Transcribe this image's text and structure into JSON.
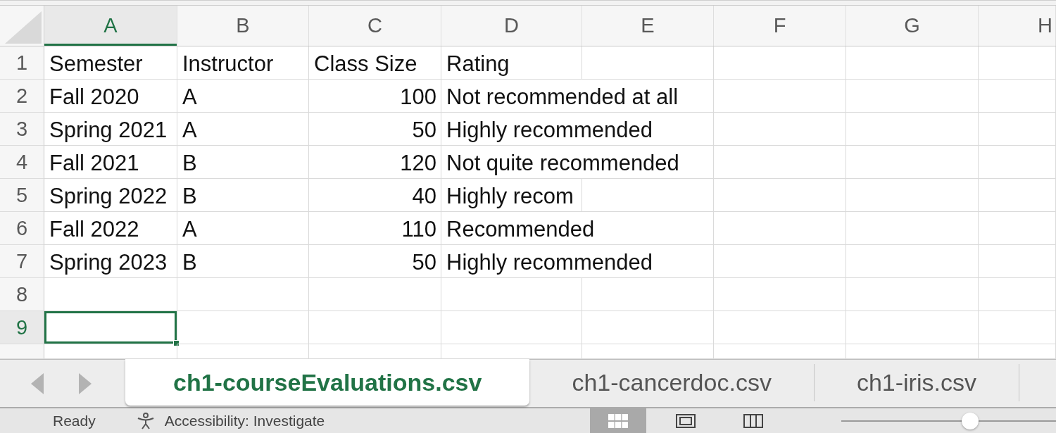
{
  "columns": [
    {
      "label": "A",
      "selected": true
    },
    {
      "label": "B",
      "selected": false
    },
    {
      "label": "C",
      "selected": false
    },
    {
      "label": "D",
      "selected": false
    },
    {
      "label": "E",
      "selected": false
    },
    {
      "label": "F",
      "selected": false
    },
    {
      "label": "G",
      "selected": false
    },
    {
      "label": "H",
      "selected": false
    }
  ],
  "rows": [
    {
      "number": "1",
      "selected": false,
      "cells": [
        {
          "text": "Semester",
          "kind": "text"
        },
        {
          "text": "Instructor",
          "kind": "text"
        },
        {
          "text": "Class Size",
          "kind": "text"
        },
        {
          "text": "Rating",
          "kind": "text"
        }
      ]
    },
    {
      "number": "2",
      "selected": false,
      "cells": [
        {
          "text": "Fall 2020",
          "kind": "text"
        },
        {
          "text": "A",
          "kind": "text"
        },
        {
          "text": "100",
          "kind": "number"
        },
        {
          "text": "Not recommended at all",
          "kind": "overflow"
        }
      ]
    },
    {
      "number": "3",
      "selected": false,
      "cells": [
        {
          "text": "Spring 2021",
          "kind": "text"
        },
        {
          "text": "A",
          "kind": "text"
        },
        {
          "text": "50",
          "kind": "number"
        },
        {
          "text": "Highly recommended",
          "kind": "overflow"
        }
      ]
    },
    {
      "number": "4",
      "selected": false,
      "cells": [
        {
          "text": "Fall 2021",
          "kind": "text"
        },
        {
          "text": "B",
          "kind": "text"
        },
        {
          "text": "120",
          "kind": "number"
        },
        {
          "text": "Not quite recommended",
          "kind": "overflow"
        }
      ]
    },
    {
      "number": "5",
      "selected": false,
      "cells": [
        {
          "text": "Spring 2022",
          "kind": "text"
        },
        {
          "text": "B",
          "kind": "text"
        },
        {
          "text": "40",
          "kind": "number"
        },
        {
          "text": "Highly recom",
          "kind": "text"
        }
      ]
    },
    {
      "number": "6",
      "selected": false,
      "cells": [
        {
          "text": "Fall 2022",
          "kind": "text"
        },
        {
          "text": "A",
          "kind": "text"
        },
        {
          "text": "110",
          "kind": "number"
        },
        {
          "text": "Recommended",
          "kind": "overflow"
        }
      ]
    },
    {
      "number": "7",
      "selected": false,
      "cells": [
        {
          "text": "Spring 2023",
          "kind": "text"
        },
        {
          "text": "B",
          "kind": "text"
        },
        {
          "text": "50",
          "kind": "number"
        },
        {
          "text": "Highly recommended",
          "kind": "overflow"
        }
      ]
    },
    {
      "number": "8",
      "selected": false
    },
    {
      "number": "9",
      "selected": true
    }
  ],
  "sheet_tabs": [
    {
      "label": "ch1-courseEvaluations.csv",
      "selected": true
    },
    {
      "label": "ch1-cancerdoc.csv",
      "selected": false
    },
    {
      "label": "ch1-iris.csv",
      "selected": false
    }
  ],
  "status_bar": {
    "status": "Ready",
    "accessibility": "Accessibility: Investigate",
    "view_buttons": [
      {
        "kind": "normal",
        "selected": true
      },
      {
        "kind": "page_layout",
        "selected": false
      },
      {
        "kind": "page_break",
        "selected": false
      }
    ],
    "zoom_slider": {
      "level": 0.6
    }
  }
}
